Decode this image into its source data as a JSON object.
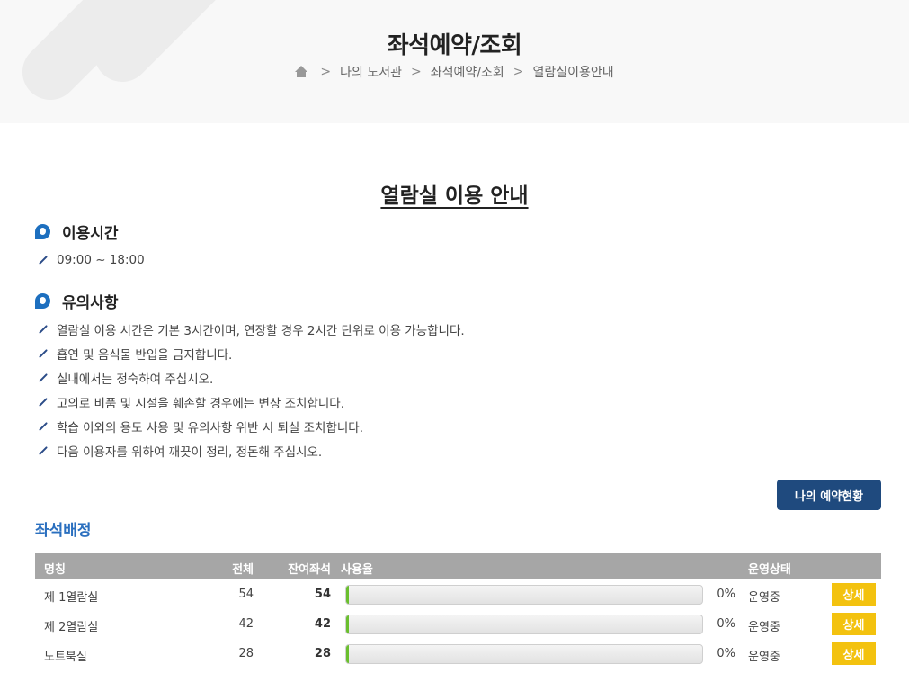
{
  "header": {
    "title": "좌석예약/조회",
    "breadcrumb": {
      "home_icon": "home-icon",
      "items": [
        "나의 도서관",
        "좌석예약/조회",
        "열람실이용안내"
      ],
      "separator": ">"
    }
  },
  "main": {
    "heading": "열람실 이용 안내",
    "sections": [
      {
        "title": "이용시간",
        "items": [
          "09:00 ~ 18:00"
        ]
      },
      {
        "title": "유의사항",
        "items": [
          "열람실 이용 시간은 기본 3시간이며, 연장할 경우 2시간 단위로 이용 가능합니다.",
          "흡연 및 음식물 반입을 금지합니다.",
          "실내에서는 정숙하여 주십시오.",
          "고의로 비품 및 시설을 훼손할 경우에는 변상 조치합니다.",
          "학습 이외의 용도 사용 및 유의사항 위반 시 퇴실 조치합니다.",
          "다음 이용자를 위하여 깨끗이 정리, 정돈해 주십시오."
        ]
      }
    ],
    "reserve_button": "나의 예약현황",
    "seat_title": "좌석배정",
    "table": {
      "columns": [
        "명칭",
        "전체",
        "잔여좌석",
        "사용율",
        "운영상태"
      ],
      "rows": [
        {
          "name": "제 1열람실",
          "total": "54",
          "remaining": "54",
          "usage_pct": 0,
          "usage_label": "0%",
          "status": "운영중",
          "detail": "상세"
        },
        {
          "name": "제 2열람실",
          "total": "42",
          "remaining": "42",
          "usage_pct": 0,
          "usage_label": "0%",
          "status": "운영중",
          "detail": "상세"
        },
        {
          "name": "노트북실",
          "total": "28",
          "remaining": "28",
          "usage_pct": 0,
          "usage_label": "0%",
          "status": "운영중",
          "detail": "상세"
        }
      ]
    }
  },
  "colors": {
    "accent_blue": "#1f4a7e",
    "section_blue": "#2a6fbf",
    "detail_yellow": "#f3c20f",
    "bar_green": "#6abf2e",
    "table_header": "#a6a6a6"
  }
}
